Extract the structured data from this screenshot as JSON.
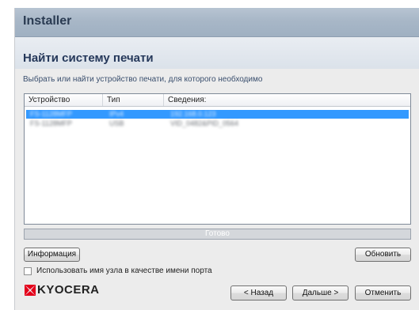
{
  "window": {
    "title": "Installer",
    "heading": "Найти систему печати",
    "subtitle": "Выбрать или найти устройство печати, для которого необходимо"
  },
  "list": {
    "columns": [
      "Устройство",
      "Тип",
      "Сведения:"
    ],
    "rows": [
      {
        "device": "FS-1128MFP",
        "type": "IPv4",
        "details": "192.168.0.123",
        "selected": true
      },
      {
        "device": "FS-1128MFP",
        "type": "USB",
        "details": "VID_0482&PID_0564",
        "selected": false
      }
    ]
  },
  "status": {
    "text": "Готово"
  },
  "buttons": {
    "info": "Информация",
    "refresh": "Обновить",
    "back": "< Назад",
    "next": "Дальше >",
    "cancel": "Отменить"
  },
  "checkbox": {
    "label": "Использовать имя узла в качестве имени порта",
    "checked": false
  },
  "brand": {
    "name": "KYOCERA",
    "mark_color": "#e4001b"
  },
  "colors": {
    "selection": "#3399ff",
    "title_bar": "#a8b7c7"
  }
}
